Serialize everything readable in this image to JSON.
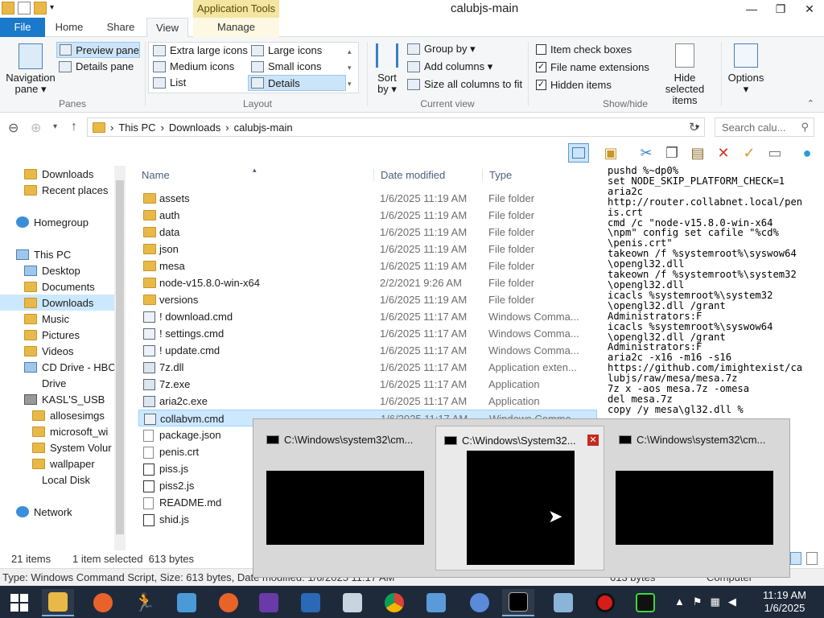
{
  "window": {
    "title": "calubjs-main",
    "app_tools": "Application Tools",
    "controls": [
      "—",
      "❐",
      "✕"
    ]
  },
  "tabs": {
    "file": "File",
    "home": "Home",
    "share": "Share",
    "view": "View",
    "manage": "Manage"
  },
  "ribbon": {
    "panes": {
      "label": "Panes",
      "navigation_pane": "Navigation",
      "navigation_pane_2": "pane ▾",
      "preview_pane": "Preview pane",
      "details_pane": "Details pane"
    },
    "layout": {
      "label": "Layout",
      "extra_large": "Extra large icons",
      "large": "Large icons",
      "medium": "Medium icons",
      "small": "Small icons",
      "list": "List",
      "details": "Details"
    },
    "current_view": {
      "label": "Current view",
      "sort_by": "Sort",
      "sort_by_2": "by ▾",
      "group_by": "Group by ▾",
      "add_columns": "Add columns ▾",
      "size_columns": "Size all columns to fit"
    },
    "show_hide": {
      "label": "Show/hide",
      "item_check_boxes": "Item check boxes",
      "item_check_boxes_checked": false,
      "file_name_extensions": "File name extensions",
      "file_name_extensions_checked": true,
      "hidden_items": "Hidden items",
      "hidden_items_checked": true,
      "hide_selected": "Hide selected",
      "hide_selected_2": "items"
    },
    "options": {
      "label": "Options",
      "arrow": "▾"
    }
  },
  "address": {
    "crumbs": [
      "This PC",
      "Downloads",
      "calubjs-main"
    ],
    "search_placeholder": "Search calu..."
  },
  "nav": {
    "items": [
      {
        "label": "Downloads",
        "icon": "folder-icon"
      },
      {
        "label": "Recent places",
        "icon": "folder-icon"
      },
      {
        "label": "Homegroup",
        "icon": "homegroup-icon"
      },
      {
        "label": "This PC",
        "icon": "computer-icon"
      },
      {
        "label": "Desktop",
        "icon": "desktop-icon"
      },
      {
        "label": "Documents",
        "icon": "folder-icon"
      },
      {
        "label": "Downloads",
        "icon": "folder-icon"
      },
      {
        "label": "Music",
        "icon": "folder-icon"
      },
      {
        "label": "Pictures",
        "icon": "folder-icon"
      },
      {
        "label": "Videos",
        "icon": "folder-icon"
      },
      {
        "label": "CD Drive - HBC",
        "icon": "cd-drive-icon"
      },
      {
        "label": "Drive",
        "icon": "drive-icon"
      },
      {
        "label": "KASL'S_USB",
        "icon": "usb-drive-icon"
      },
      {
        "label": "allosesimgs",
        "icon": "folder-icon"
      },
      {
        "label": "microsoft_wi",
        "icon": "folder-icon"
      },
      {
        "label": "System Volur",
        "icon": "folder-icon"
      },
      {
        "label": "wallpaper",
        "icon": "folder-icon"
      },
      {
        "label": "Local Disk",
        "icon": "drive-icon"
      },
      {
        "label": "Network",
        "icon": "network-icon"
      }
    ]
  },
  "columns": {
    "name": "Name",
    "date": "Date modified",
    "type": "Type"
  },
  "files": [
    {
      "name": "assets",
      "date": "1/6/2025 11:19 AM",
      "type": "File folder",
      "icon": "folder"
    },
    {
      "name": "auth",
      "date": "1/6/2025 11:19 AM",
      "type": "File folder",
      "icon": "folder"
    },
    {
      "name": "data",
      "date": "1/6/2025 11:19 AM",
      "type": "File folder",
      "icon": "folder"
    },
    {
      "name": "json",
      "date": "1/6/2025 11:19 AM",
      "type": "File folder",
      "icon": "folder"
    },
    {
      "name": "mesa",
      "date": "1/6/2025 11:19 AM",
      "type": "File folder",
      "icon": "folder"
    },
    {
      "name": "node-v15.8.0-win-x64",
      "date": "2/2/2021 9:26 AM",
      "type": "File folder",
      "icon": "folder"
    },
    {
      "name": "versions",
      "date": "1/6/2025 11:19 AM",
      "type": "File folder",
      "icon": "folder"
    },
    {
      "name": "! download.cmd",
      "date": "1/6/2025 11:17 AM",
      "type": "Windows Comma...",
      "icon": "cmd"
    },
    {
      "name": "! settings.cmd",
      "date": "1/6/2025 11:17 AM",
      "type": "Windows Comma...",
      "icon": "cmd"
    },
    {
      "name": "! update.cmd",
      "date": "1/6/2025 11:17 AM",
      "type": "Windows Comma...",
      "icon": "cmd"
    },
    {
      "name": "7z.dll",
      "date": "1/6/2025 11:17 AM",
      "type": "Application exten...",
      "icon": "dll"
    },
    {
      "name": "7z.exe",
      "date": "1/6/2025 11:17 AM",
      "type": "Application",
      "icon": "exe"
    },
    {
      "name": "aria2c.exe",
      "date": "1/6/2025 11:17 AM",
      "type": "Application",
      "icon": "exe"
    },
    {
      "name": "collabvm.cmd",
      "date": "1/6/2025 11:17 AM",
      "type": "Windows Comma...",
      "icon": "cmd"
    },
    {
      "name": "package.json",
      "date": "",
      "type": "",
      "icon": "txt"
    },
    {
      "name": "penis.crt",
      "date": "",
      "type": "",
      "icon": "txt"
    },
    {
      "name": "piss.js",
      "date": "",
      "type": "",
      "icon": "js"
    },
    {
      "name": "piss2.js",
      "date": "",
      "type": "",
      "icon": "js"
    },
    {
      "name": "README.md",
      "date": "",
      "type": "",
      "icon": "txt"
    },
    {
      "name": "shid.js",
      "date": "",
      "type": "",
      "icon": "js"
    }
  ],
  "preview_text": "pushd %~dp0%\nset NODE_SKIP_PLATFORM_CHECK=1\naria2c\nhttp://router.collabnet.local/pen\nis.crt\ncmd /c \"node-v15.8.0-win-x64\n\\npm\" config set cafile \"%cd%\n\\penis.crt\"\ntakeown /f %systemroot%\\syswow64\n\\opengl32.dll\ntakeown /f %systemroot%\\system32\n\\opengl32.dll\nicacls %systemroot%\\system32\n\\opengl32.dll /grant\nAdministrators:F\nicacls %systemroot%\\syswow64\n\\opengl32.dll /grant\nAdministrators:F\naria2c -x16 -m16 -s16\nhttps://github.com/imightexist/ca\nlubjs/raw/mesa/mesa.7z\n7z x -aos mesa.7z -omesa\ndel mesa.7z\ncopy /y mesa\\gl32.dll %",
  "status": {
    "count": "21 items",
    "selected": "1 item selected  613 bytes"
  },
  "details_bar": {
    "text": "Type: Windows Command Script, Size: 613 bytes, Date modified: 1/6/2025 11:17 AM",
    "right1": "613 bytes",
    "right2": "Computer"
  },
  "thumbnails": [
    {
      "title": "C:\\Windows\\system32\\cm..."
    },
    {
      "title": "C:\\Windows\\System32..."
    },
    {
      "title": "C:\\Windows\\system32\\cm..."
    }
  ],
  "clock": {
    "time": "11:19 AM",
    "date": "1/6/2025"
  },
  "colors": {
    "accent": "#1979ca",
    "selection": "#cce8ff",
    "taskbar": "#1e2a3a",
    "app_tools": "#f4e5a3"
  }
}
